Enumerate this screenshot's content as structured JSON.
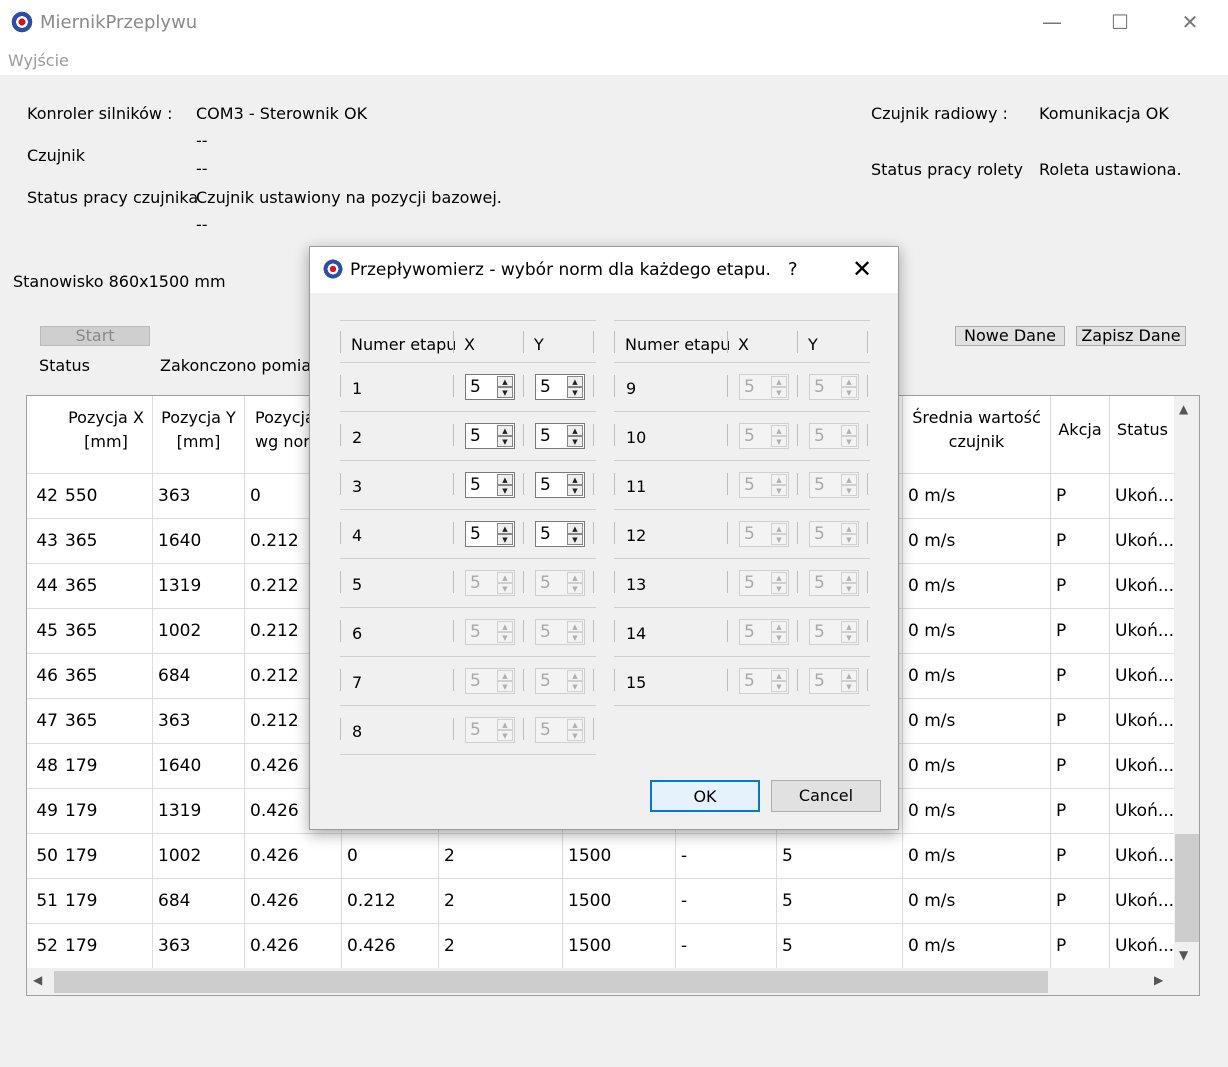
{
  "window": {
    "title": "MiernikPrzeplywu",
    "minimize": "—",
    "maximize": "☐",
    "close": "✕"
  },
  "menu": {
    "exit": "Wyjście"
  },
  "info": {
    "motor_label": "Konroler silników :",
    "motor_value": "COM3 - Sterownik OK",
    "dash1": "--",
    "sensor_label": "Czujnik",
    "dash2": "--",
    "sensor_status_label": "Status pracy czujnika",
    "sensor_status_value": "Czujnik ustawiony na pozycji bazowej.",
    "dash3": "--",
    "radio_label": "Czujnik radiowy :",
    "radio_value": "Komunikacja OK",
    "blind_label": "Status pracy rolety",
    "blind_value": "Roleta ustawiona."
  },
  "station": "Stanowisko 860x1500 mm",
  "buttons": {
    "start": "Start",
    "new_data": "Nowe Dane",
    "save_data": "Zapisz Dane"
  },
  "status": {
    "label": "Status",
    "value": "Zakonczono pomiar c"
  },
  "table": {
    "headers": [
      "Pozycja X [mm]",
      "Pozycja Y [mm]",
      "Pozycja wg nor",
      "",
      "",
      "",
      "",
      "",
      "Średnia wartość czujnik",
      "Akcja",
      "Status"
    ],
    "rows": [
      {
        "n": "42",
        "x": "550",
        "y": "363",
        "p": "0",
        "c5": "",
        "c6": "",
        "c7": "",
        "c8": "",
        "c9": "",
        "avg": "0 m/s",
        "akcja": "P",
        "status": "Ukoń..."
      },
      {
        "n": "43",
        "x": "365",
        "y": "1640",
        "p": "0.212",
        "c5": "",
        "c6": "",
        "c7": "",
        "c8": "",
        "c9": "",
        "avg": "0 m/s",
        "akcja": "P",
        "status": "Ukoń..."
      },
      {
        "n": "44",
        "x": "365",
        "y": "1319",
        "p": "0.212",
        "c5": "",
        "c6": "",
        "c7": "",
        "c8": "",
        "c9": "",
        "avg": "0 m/s",
        "akcja": "P",
        "status": "Ukoń..."
      },
      {
        "n": "45",
        "x": "365",
        "y": "1002",
        "p": "0.212",
        "c5": "",
        "c6": "",
        "c7": "",
        "c8": "",
        "c9": "",
        "avg": "0 m/s",
        "akcja": "P",
        "status": "Ukoń..."
      },
      {
        "n": "46",
        "x": "365",
        "y": "684",
        "p": "0.212",
        "c5": "",
        "c6": "",
        "c7": "",
        "c8": "",
        "c9": "",
        "avg": "0 m/s",
        "akcja": "P",
        "status": "Ukoń..."
      },
      {
        "n": "47",
        "x": "365",
        "y": "363",
        "p": "0.212",
        "c5": "",
        "c6": "",
        "c7": "",
        "c8": "",
        "c9": "",
        "avg": "0 m/s",
        "akcja": "P",
        "status": "Ukoń..."
      },
      {
        "n": "48",
        "x": "179",
        "y": "1640",
        "p": "0.426",
        "c5": "",
        "c6": "",
        "c7": "",
        "c8": "",
        "c9": "",
        "avg": "0 m/s",
        "akcja": "P",
        "status": "Ukoń..."
      },
      {
        "n": "49",
        "x": "179",
        "y": "1319",
        "p": "0.426",
        "c5": "",
        "c6": "",
        "c7": "",
        "c8": "",
        "c9": "",
        "avg": "0 m/s",
        "akcja": "P",
        "status": "Ukoń..."
      },
      {
        "n": "50",
        "x": "179",
        "y": "1002",
        "p": "0.426",
        "c5": "0",
        "c6": "2",
        "c7": "1500",
        "c8": "-",
        "c9": "5",
        "avg": "0 m/s",
        "akcja": "P",
        "status": "Ukoń..."
      },
      {
        "n": "51",
        "x": "179",
        "y": "684",
        "p": "0.426",
        "c5": "0.212",
        "c6": "2",
        "c7": "1500",
        "c8": "-",
        "c9": "5",
        "avg": "0 m/s",
        "akcja": "P",
        "status": "Ukoń..."
      },
      {
        "n": "52",
        "x": "179",
        "y": "363",
        "p": "0.426",
        "c5": "0.426",
        "c6": "2",
        "c7": "1500",
        "c8": "-",
        "c9": "5",
        "avg": "0 m/s",
        "akcja": "P",
        "status": "Ukoń..."
      }
    ]
  },
  "dialog": {
    "title": "Przepływomierz - wybór norm dla każdego etapu.",
    "help": "?",
    "close": "✕",
    "col_stage": "Numer etapu",
    "col_x": "X",
    "col_y": "Y",
    "stages": [
      {
        "num": "1",
        "x": "5",
        "y": "5"
      },
      {
        "num": "2",
        "x": "5",
        "y": "5"
      },
      {
        "num": "3",
        "x": "5",
        "y": "5"
      },
      {
        "num": "4",
        "x": "5",
        "y": "5"
      },
      {
        "num": "5",
        "x": "5",
        "y": "5"
      },
      {
        "num": "6",
        "x": "5",
        "y": "5"
      },
      {
        "num": "7",
        "x": "5",
        "y": "5"
      },
      {
        "num": "8",
        "x": "5",
        "y": "5"
      },
      {
        "num": "9",
        "x": "5",
        "y": "5"
      },
      {
        "num": "10",
        "x": "5",
        "y": "5"
      },
      {
        "num": "11",
        "x": "5",
        "y": "5"
      },
      {
        "num": "12",
        "x": "5",
        "y": "5"
      },
      {
        "num": "13",
        "x": "5",
        "y": "5"
      },
      {
        "num": "14",
        "x": "5",
        "y": "5"
      },
      {
        "num": "15",
        "x": "5",
        "y": "5"
      }
    ],
    "ok": "OK",
    "cancel": "Cancel"
  }
}
